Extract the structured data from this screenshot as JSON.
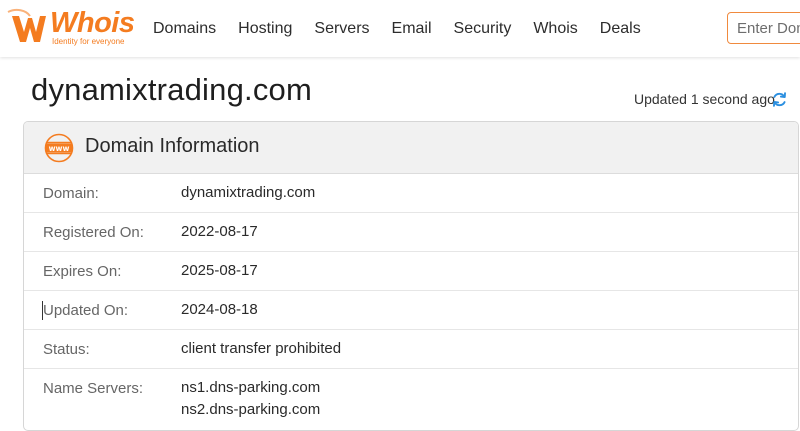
{
  "brand": {
    "name": "Whois",
    "tagline": "Identity for everyone",
    "accent_color": "#f47c20"
  },
  "nav": {
    "items": [
      {
        "label": "Domains"
      },
      {
        "label": "Hosting"
      },
      {
        "label": "Servers"
      },
      {
        "label": "Email"
      },
      {
        "label": "Security"
      },
      {
        "label": "Whois"
      },
      {
        "label": "Deals"
      }
    ]
  },
  "search": {
    "placeholder": "Enter Domain"
  },
  "page": {
    "title": "dynamixtrading.com",
    "updated": "Updated 1 second ago"
  },
  "card": {
    "title": "Domain Information",
    "icon": "www-icon",
    "rows": [
      {
        "label": "Domain:",
        "value": "dynamixtrading.com"
      },
      {
        "label": "Registered On:",
        "value": "2022-08-17"
      },
      {
        "label": "Expires On:",
        "value": "2025-08-17"
      },
      {
        "label": "Updated On:",
        "value": "2024-08-18"
      },
      {
        "label": "Status:",
        "value": "client transfer prohibited"
      },
      {
        "label": "Name Servers:",
        "values": [
          "ns1.dns-parking.com",
          "ns2.dns-parking.com"
        ]
      }
    ]
  }
}
